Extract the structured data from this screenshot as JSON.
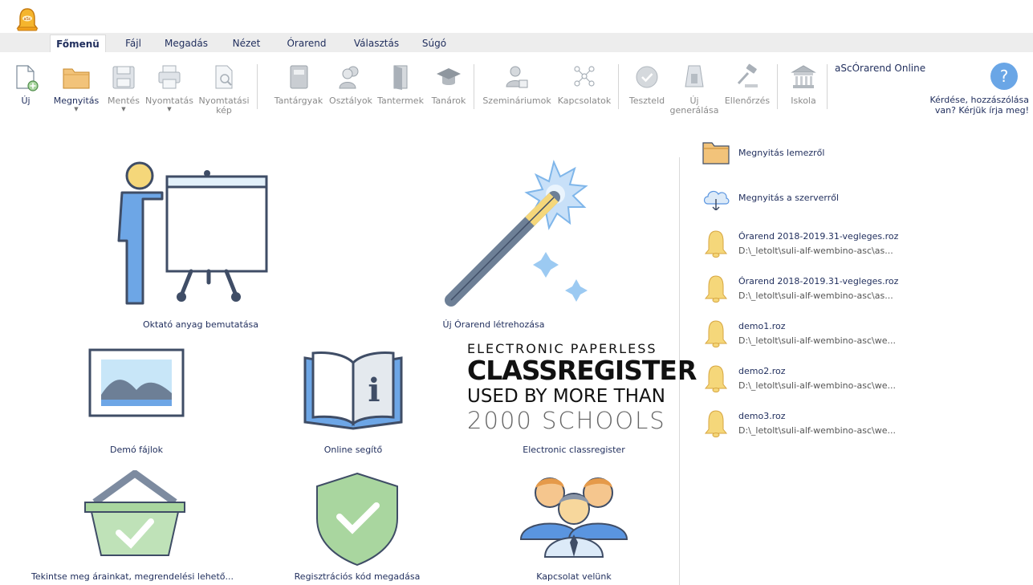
{
  "app": {
    "logo_text": "aSc"
  },
  "tabs": [
    {
      "label": "Főmenü",
      "active": true
    },
    {
      "label": "Fájl"
    },
    {
      "label": "Megadás"
    },
    {
      "label": "Nézet"
    },
    {
      "label": "Órarend"
    },
    {
      "label": "Választás"
    },
    {
      "label": "Súgó"
    }
  ],
  "ribbon": {
    "new": "Új",
    "open": "Megnyitás",
    "save": "Mentés",
    "print": "Nyomtatás",
    "print_preview_1": "Nyomtatási",
    "print_preview_2": "kép",
    "subjects": "Tantárgyak",
    "classes": "Osztályok",
    "rooms": "Tantermek",
    "teachers": "Tanárok",
    "seminars": "Szemináriumok",
    "relations": "Kapcsolatok",
    "test": "Teszteld",
    "generate_1": "Új",
    "generate_2": "generálása",
    "check": "Ellenőrzés",
    "school": "Iskola",
    "online": "aScÓrarend Online",
    "help_1": "Kérdése, hozzászólása",
    "help_2": "van? Kérjük írja meg!",
    "help_symbol": "?"
  },
  "tiles": {
    "tutorial": "Oktató anyag bemutatása",
    "new_timetable": "Új Órarend létrehozása",
    "demo": "Demó fájlok",
    "online_help": "Online segítő",
    "classregister": "Electronic classregister",
    "pricing": "Tekintse meg árainkat, megrendelési lehető...",
    "registration": "Regisztrációs kód megadása",
    "contact": "Kapcsolat velünk"
  },
  "slogan": {
    "line1": "ELECTRONIC PAPERLESS",
    "line2": "CLASSREGISTER",
    "line3": "USED BY MORE THAN",
    "line4": "2000 SCHOOLS"
  },
  "sidebar": {
    "open_disk": "Megnyitás lemezről",
    "open_server": "Megnyitás a szerverről",
    "recent": [
      {
        "name": "Órarend 2018-2019.31-vegleges.roz",
        "path": "D:\\_letolt\\suli-alf-wembino-asc\\as..."
      },
      {
        "name": "Órarend 2018-2019.31-vegleges.roz",
        "path": "D:\\_letolt\\suli-alf-wembino-asc\\as..."
      },
      {
        "name": "demo1.roz",
        "path": "D:\\_letolt\\suli-alf-wembino-asc\\we..."
      },
      {
        "name": "demo2.roz",
        "path": "D:\\_letolt\\suli-alf-wembino-asc\\we..."
      },
      {
        "name": "demo3.roz",
        "path": "D:\\_letolt\\suli-alf-wembino-asc\\we..."
      }
    ]
  },
  "colors": {
    "text": "#1f2d5c",
    "bell": "#f5d77a",
    "folder": "#f2c37a",
    "accent_blue": "#6aa6e6"
  }
}
